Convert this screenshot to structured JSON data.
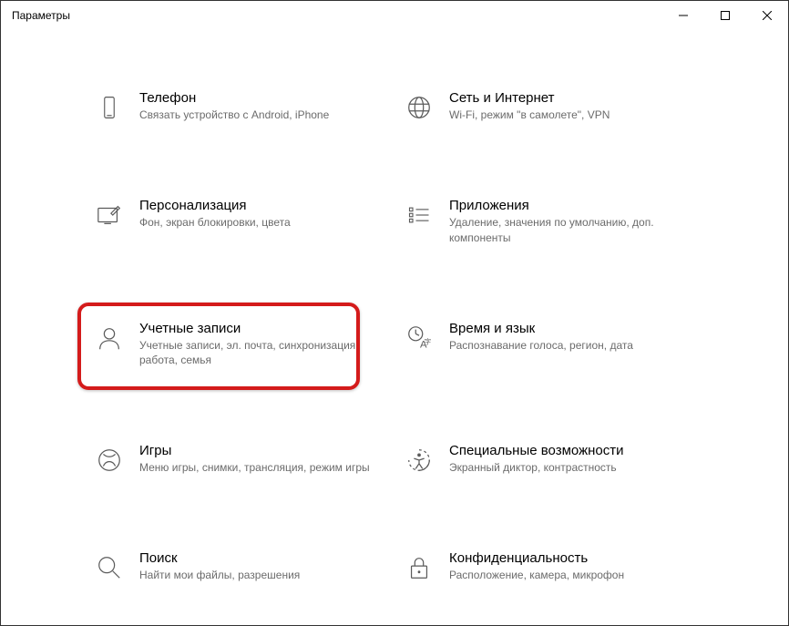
{
  "window": {
    "title": "Параметры"
  },
  "tiles": {
    "phone": {
      "title": "Телефон",
      "desc": "Связать устройство с Android, iPhone"
    },
    "network": {
      "title": "Сеть и Интернет",
      "desc": "Wi-Fi, режим \"в самолете\", VPN"
    },
    "personalization": {
      "title": "Персонализация",
      "desc": "Фон, экран блокировки, цвета"
    },
    "apps": {
      "title": "Приложения",
      "desc": "Удаление, значения по умолчанию, доп. компоненты"
    },
    "accounts": {
      "title": "Учетные записи",
      "desc": "Учетные записи, эл. почта, синхронизация, работа, семья"
    },
    "timeLanguage": {
      "title": "Время и язык",
      "desc": "Распознавание голоса, регион, дата"
    },
    "gaming": {
      "title": "Игры",
      "desc": "Меню игры, снимки, трансляция, режим игры"
    },
    "accessibility": {
      "title": "Специальные возможности",
      "desc": "Экранный диктор, контрастность"
    },
    "search": {
      "title": "Поиск",
      "desc": "Найти мои файлы, разрешения"
    },
    "privacy": {
      "title": "Конфиденциальность",
      "desc": "Расположение, камера, микрофон"
    }
  }
}
